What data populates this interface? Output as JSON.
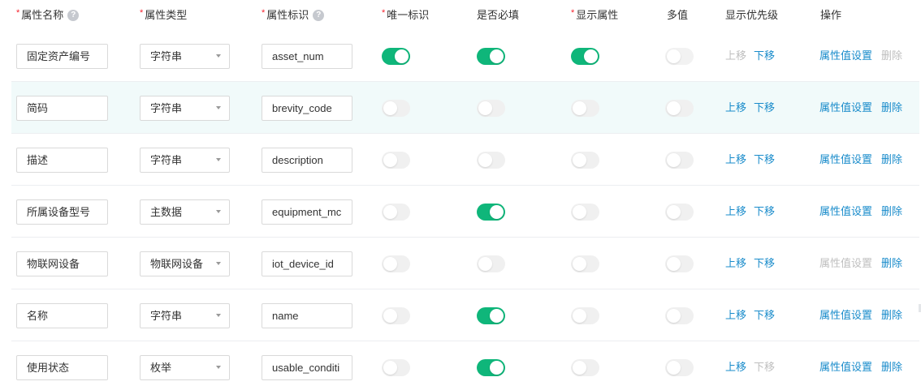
{
  "header": {
    "name": "属性名称",
    "type": "属性类型",
    "code": "属性标识",
    "unique": "唯一标识",
    "required": "是否必填",
    "display": "显示属性",
    "multi": "多值",
    "priority": "显示优先级",
    "ops": "操作",
    "help_glyph": "?",
    "required_mark": "*"
  },
  "actions": {
    "move_up": "上移",
    "move_down": "下移",
    "value_settings": "属性值设置",
    "delete": "删除"
  },
  "colors": {
    "switch_on": "#0fb67a",
    "link": "#1a8ccb",
    "required_mark": "#f5222d",
    "row_highlight": "#f1fafa"
  },
  "rows": [
    {
      "name": "固定资产编号",
      "type": "字符串",
      "code": "asset_num",
      "unique": true,
      "required": true,
      "display": true,
      "multi": false,
      "multi_disabled": true,
      "up_disabled": true,
      "down_disabled": false,
      "value_disabled": false,
      "delete_disabled": true
    },
    {
      "name": "简码",
      "type": "字符串",
      "code": "brevity_code",
      "unique": false,
      "required": false,
      "display": false,
      "multi": false,
      "multi_disabled": false,
      "up_disabled": false,
      "down_disabled": false,
      "value_disabled": false,
      "delete_disabled": false
    },
    {
      "name": "描述",
      "type": "字符串",
      "code": "description",
      "unique": false,
      "required": false,
      "display": false,
      "multi": false,
      "multi_disabled": false,
      "up_disabled": false,
      "down_disabled": false,
      "value_disabled": false,
      "delete_disabled": false
    },
    {
      "name": "所属设备型号",
      "type": "主数据",
      "code": "equipment_mc",
      "unique": false,
      "required": true,
      "display": false,
      "multi": false,
      "multi_disabled": false,
      "up_disabled": false,
      "down_disabled": false,
      "value_disabled": false,
      "delete_disabled": false
    },
    {
      "name": "物联网设备",
      "type": "物联网设备",
      "code": "iot_device_id",
      "unique": false,
      "required": false,
      "display": false,
      "multi": false,
      "multi_disabled": false,
      "up_disabled": false,
      "down_disabled": false,
      "value_disabled": true,
      "delete_disabled": false
    },
    {
      "name": "名称",
      "type": "字符串",
      "code": "name",
      "unique": false,
      "required": true,
      "display": false,
      "multi": false,
      "multi_disabled": false,
      "up_disabled": false,
      "down_disabled": false,
      "value_disabled": false,
      "delete_disabled": false
    },
    {
      "name": "使用状态",
      "type": "枚举",
      "code": "usable_conditi",
      "unique": false,
      "required": true,
      "display": false,
      "multi": false,
      "multi_disabled": false,
      "up_disabled": false,
      "down_disabled": true,
      "value_disabled": false,
      "delete_disabled": false
    }
  ]
}
